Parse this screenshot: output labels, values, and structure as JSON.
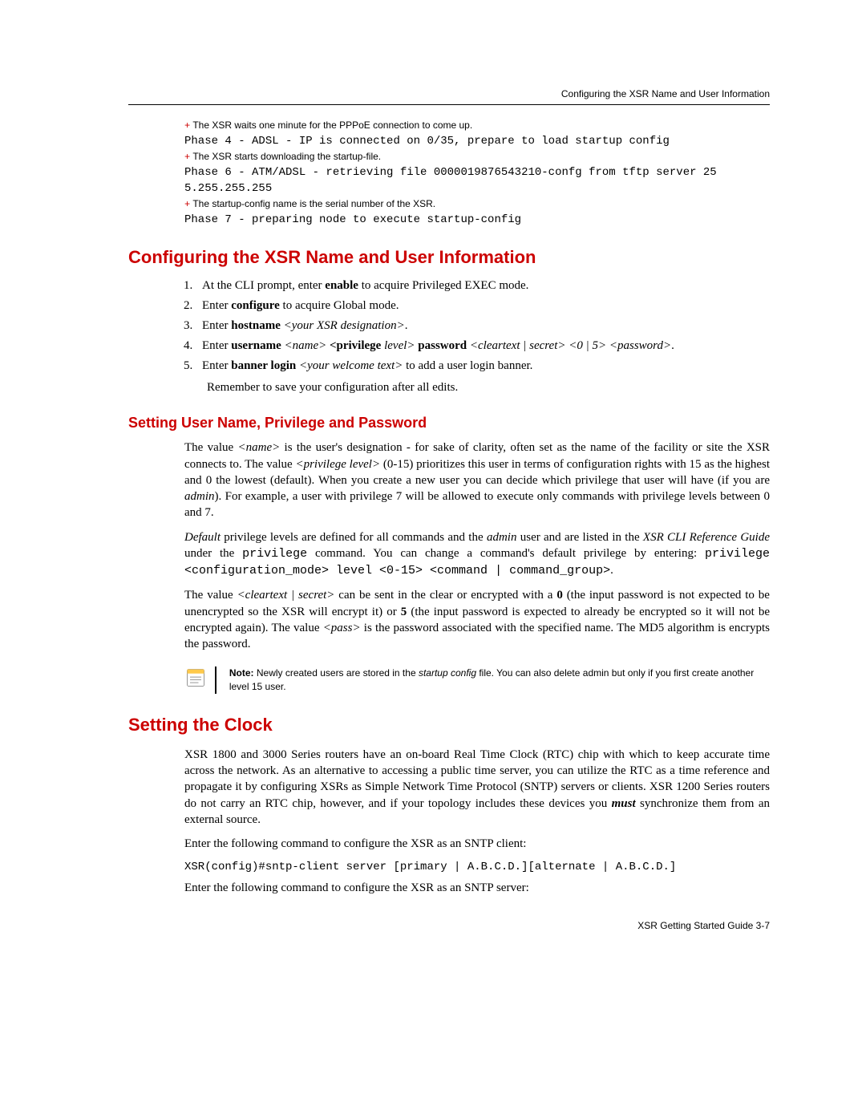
{
  "header_right": "Configuring the XSR Name and User Information",
  "pre": {
    "a1": "The XSR waits one minute for the PPPoE connection to come up.",
    "l1": "Phase 4 - ADSL - IP is connected on 0/35, prepare to load startup config",
    "a2": "The XSR starts downloading the startup-file.",
    "l2a": "Phase 6 - ATM/ADSL - retrieving file 0000019876543210-confg from tftp server 25",
    "l2b": "5.255.255.255",
    "a3": "The startup-config name is the serial number of the XSR.",
    "l3": "Phase 7 - preparing node to execute startup-config"
  },
  "h2a": "Configuring the XSR Name and User Information",
  "steps": {
    "s1a": "At the CLI prompt, enter ",
    "s1b": "enable",
    "s1c": " to acquire Privileged EXEC mode.",
    "s2a": "Enter ",
    "s2b": "configure",
    "s2c": " to acquire Global mode.",
    "s3a": "Enter ",
    "s3b": "hostname",
    "s3c": " <your XSR designation>",
    "s3d": ".",
    "s4a": "Enter ",
    "s4b": "username",
    "s4c": " <name> ",
    "s4d": "<privilege",
    "s4e": " level> ",
    "s4f": "password",
    "s4g": " <cleartext | secret> <0 | 5> <password>",
    "s4h": ".",
    "s5a": "Enter ",
    "s5b": "banner login",
    "s5c": " <your welcome text>",
    "s5d": " to add a user login banner."
  },
  "remember": "Remember to save your configuration after all edits.",
  "h3a": "Setting User Name, Privilege and Password",
  "p1a": "The value ",
  "p1b": "<name>",
  "p1c": " is the user's designation - for sake of clarity, often set as the name of the facility or site the XSR connects to. The value ",
  "p1d": "<privilege level>",
  "p1e": " (0-15) prioritizes this user in terms of configuration rights with 15 as the highest and 0 the lowest (default). When you create a new user you can decide which privilege that user will have (if you are ",
  "p1f": "admin",
  "p1g": "). For example, a user with privilege 7 will be allowed to execute only commands with privilege levels between 0 and 7.",
  "p2a": "Default",
  "p2b": " privilege levels are defined for all commands and the ",
  "p2c": "admin",
  "p2d": " user and are listed in the ",
  "p2e": "XSR CLI Reference Guide",
  "p2f": " under the ",
  "p2g": "privilege",
  "p2h": " command. You can change a command's default privilege by entering: ",
  "p2i": "privilege <configuration_mode> level <0-15> <command | command_group>",
  "p2j": ".",
  "p3a": "The value ",
  "p3b": "<cleartext | secret>",
  "p3c": " can be sent in the clear or encrypted with a ",
  "p3d": "0",
  "p3e": " (the input password is not expected to be unencrypted so the XSR will encrypt it) or ",
  "p3f": "5",
  "p3g": " (the input password is expected to already be encrypted so it will not be encrypted again). The value ",
  "p3h": "<pass>",
  "p3i": " is the password associated with the specified name. The MD5 algorithm is encrypts the password.",
  "note_bold": "Note:",
  "note_a": " Newly created users are stored in the ",
  "note_i": "startup config",
  "note_b": " file. You can also delete admin but only if you first create another level 15 user.",
  "h2b": "Setting the Clock",
  "clock_p1a": "XSR 1800 and 3000 Series routers have an on-board Real Time Clock (RTC) chip with which to keep accurate time across the network. As an alternative to accessing a public time server, you can utilize the RTC as a time reference and propagate it by configuring XSRs as Simple Network Time Protocol (SNTP) servers or clients. XSR 1200 Series routers do not carry an RTC chip, however, and if your topology includes these devices you ",
  "clock_p1b": "must",
  "clock_p1c": " synchronize them from an external source.",
  "clock_p2": "Enter the following command to configure the XSR as an SNTP client:",
  "clock_cmd": "XSR(config)#sntp-client server [primary | A.B.C.D.][alternate | A.B.C.D.]",
  "clock_p3": "Enter the following command to configure the XSR as an SNTP server:",
  "footer": "XSR Getting Started Guide   3-7"
}
